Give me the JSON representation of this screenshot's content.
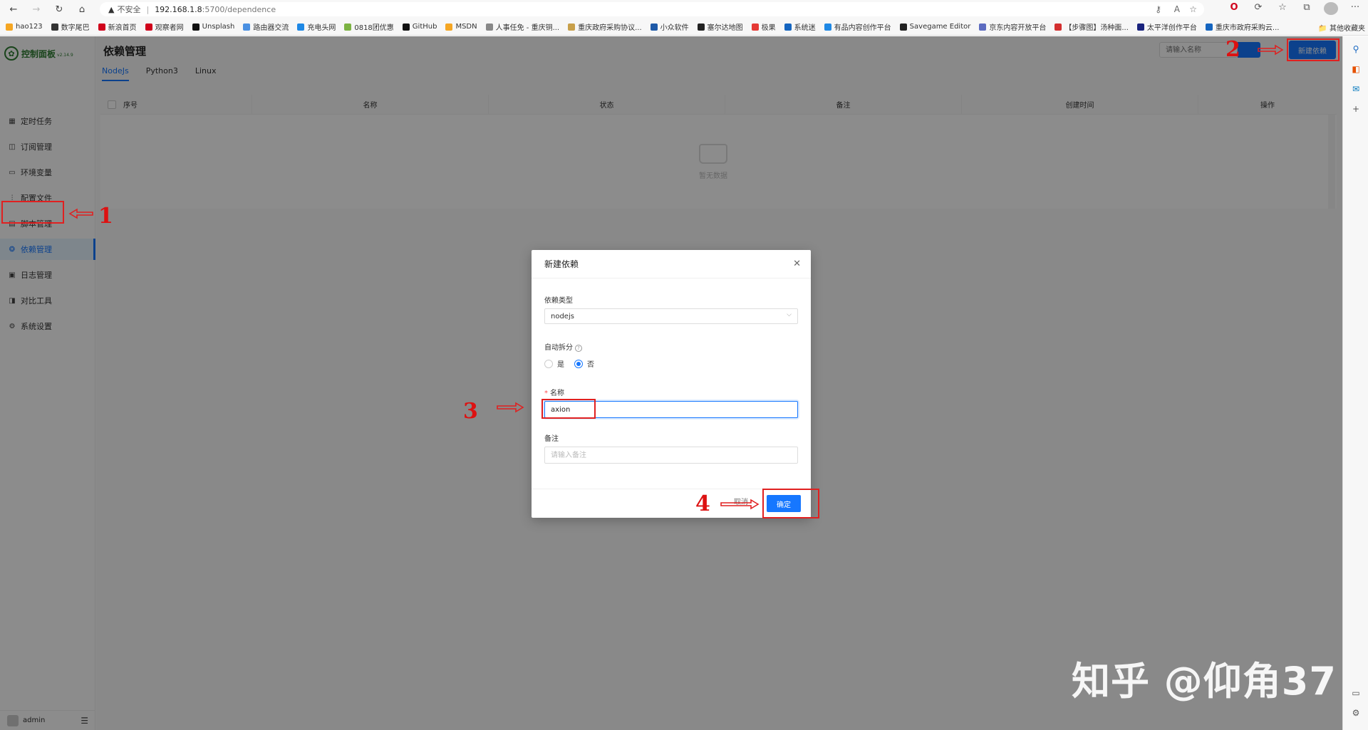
{
  "browser": {
    "warning": "不安全",
    "url_host": "192.168.1.8",
    "url_path": ":5700/dependence",
    "bookmarks": [
      {
        "label": "hao123",
        "color": "#f5a623"
      },
      {
        "label": "数字尾巴",
        "color": "#333333"
      },
      {
        "label": "新浪首页",
        "color": "#d0021b"
      },
      {
        "label": "观察者网",
        "color": "#d0021b"
      },
      {
        "label": "Unsplash",
        "color": "#111111"
      },
      {
        "label": "路由器交流",
        "color": "#4a90e2"
      },
      {
        "label": "充电头网",
        "color": "#1e88e5"
      },
      {
        "label": "0818团优惠",
        "color": "#7cb342"
      },
      {
        "label": "GitHub",
        "color": "#111111"
      },
      {
        "label": "MSDN",
        "color": "#f5a623"
      },
      {
        "label": "人事任免 - 重庆铜...",
        "color": "#888888"
      },
      {
        "label": "重庆政府采购协议...",
        "color": "#c8a04a"
      },
      {
        "label": "小众软件",
        "color": "#1e5aa8"
      },
      {
        "label": "塞尔达地图",
        "color": "#222222"
      },
      {
        "label": "极果",
        "color": "#e53935"
      },
      {
        "label": "系统迷",
        "color": "#1565c0"
      },
      {
        "label": "有品内容创作平台",
        "color": "#1e88e5"
      },
      {
        "label": "Savegame Editor",
        "color": "#222222"
      },
      {
        "label": "京东内容开放平台",
        "color": "#5c6bc0"
      },
      {
        "label": "【步骤图】汤种面...",
        "color": "#d32f2f"
      },
      {
        "label": "太平洋创作平台",
        "color": "#1a237e"
      },
      {
        "label": "重庆市政府采购云...",
        "color": "#1565c0"
      }
    ],
    "other_bookmarks": "其他收藏夹"
  },
  "sidebar": {
    "logo_text": "控制面板",
    "logo_version": "v2.14.9",
    "items": [
      {
        "label": "定时任务",
        "icon": "calendar-icon"
      },
      {
        "label": "订阅管理",
        "icon": "subscription-icon"
      },
      {
        "label": "环境变量",
        "icon": "monitor-icon"
      },
      {
        "label": "配置文件",
        "icon": "sliders-icon"
      },
      {
        "label": "脚本管理",
        "icon": "script-icon"
      },
      {
        "label": "依赖管理",
        "icon": "dependency-icon"
      },
      {
        "label": "日志管理",
        "icon": "log-icon"
      },
      {
        "label": "对比工具",
        "icon": "diff-icon"
      },
      {
        "label": "系统设置",
        "icon": "gear-icon"
      }
    ],
    "active_index": 5,
    "user": "admin"
  },
  "main": {
    "title": "依赖管理",
    "search_placeholder": "请输入名称",
    "create_button": "新建依赖",
    "tabs": [
      "NodeJs",
      "Python3",
      "Linux"
    ],
    "active_tab": 0,
    "columns": [
      "序号",
      "名称",
      "状态",
      "备注",
      "创建时间",
      "操作"
    ],
    "empty_text": "暂无数据"
  },
  "modal": {
    "title": "新建依赖",
    "type_label": "依赖类型",
    "type_value": "nodejs",
    "auto_split_label": "自动拆分",
    "radio_yes": "是",
    "radio_no": "否",
    "radio_selected": "否",
    "name_label": "名称",
    "name_value": "axion",
    "remark_label": "备注",
    "remark_placeholder": "请输入备注",
    "cancel": "取消",
    "ok": "确定"
  },
  "annotations": {
    "steps": [
      "1",
      "2",
      "3",
      "4"
    ],
    "color": "#e02020"
  },
  "watermark": "知乎 @仰角37",
  "colors": {
    "primary": "#1677ff",
    "brand_green": "#2e7d32",
    "annotation_red": "#e02020"
  }
}
